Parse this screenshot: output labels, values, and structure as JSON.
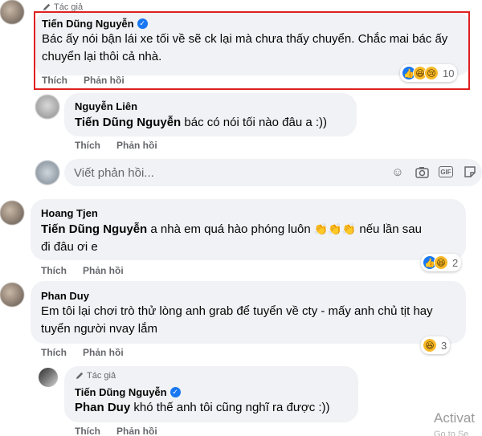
{
  "comment1": {
    "author_tag": "Tác giả",
    "name": "Tiến Dũng Nguyễn",
    "text": "Bác ấy nói bận lái xe tối về sẽ ck lại mà chưa thấy chuyển. Chắc mai bác ấy chuyển lại thôi cả nhà.",
    "like_label": "Thích",
    "reply_label": "Phản hồi",
    "reactions": [
      "like",
      "haha",
      "sad"
    ],
    "reaction_count": "10"
  },
  "reply1": {
    "name": "Nguyễn Liên",
    "mention": "Tiến Dũng Nguyễn",
    "text": " bác có nói tối nào đâu a :))",
    "like_label": "Thích",
    "reply_label": "Phản hồi"
  },
  "reply_box": {
    "placeholder": "Viết phản hồi...",
    "icons": [
      "emoji-icon",
      "camera-icon",
      "gif-icon",
      "sticker-icon"
    ]
  },
  "comment2": {
    "name": "Hoang Tjen",
    "mention": "Tiến Dũng Nguyễn",
    "text_line1": " a nhà em quá hào phóng luôn ",
    "clap_emojis": "👏👏👏",
    "text_after": " nếu lần sau",
    "text_line2": "đi đâu ơi e",
    "like_label": "Thích",
    "reply_label": "Phản hồi",
    "reactions": [
      "like",
      "haha"
    ],
    "reaction_count": "2"
  },
  "comment3": {
    "name": "Phan Duy",
    "text": "Em tôi lại chơi trò thử lòng anh grab để tuyển về cty - mấy anh chủ tịt hay tuyển người nvay lắm",
    "like_label": "Thích",
    "reply_label": "Phản hồi",
    "reactions": [
      "haha"
    ],
    "reaction_count": "3"
  },
  "reply3": {
    "author_tag": "Tác giả",
    "name": "Tiến Dũng Nguyễn",
    "mention": "Phan Duy",
    "text": " khó thế anh tôi cũng nghĩ ra được :))",
    "like_label": "Thích",
    "reply_label": "Phản hồi"
  },
  "watermark": {
    "line1": "Activat",
    "line2": "Go to Se"
  },
  "colors": {
    "highlight": "#e02020",
    "bubble": "#f0f2f5",
    "verified": "#1877f2"
  }
}
